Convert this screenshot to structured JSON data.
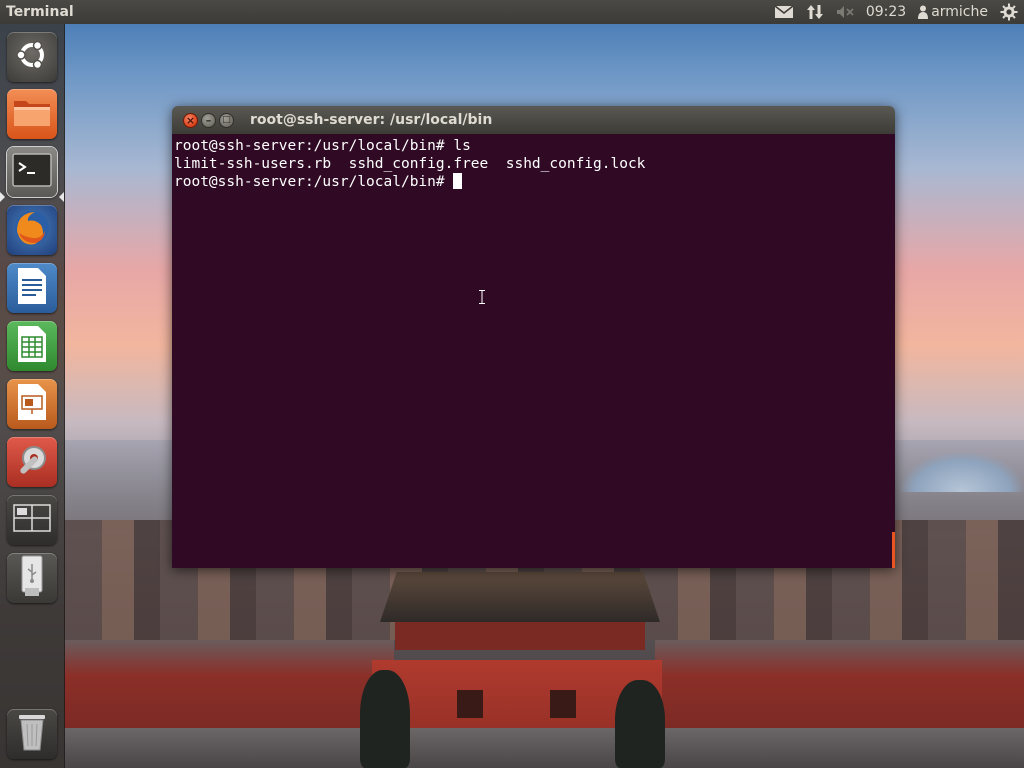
{
  "top_panel": {
    "app_title": "Terminal",
    "indicators": {
      "mail_icon": "mail-icon",
      "network_icon": "network-updown-icon",
      "volume_icon": "volume-muted-icon",
      "clock": "09:23",
      "user_name": "armiche",
      "session_icon": "gear-icon"
    }
  },
  "launcher": {
    "items": [
      {
        "name": "Dash Home",
        "icon": "ubuntu-logo-icon"
      },
      {
        "name": "Files",
        "icon": "folder-icon"
      },
      {
        "name": "Terminal",
        "icon": "terminal-icon",
        "active": true
      },
      {
        "name": "Firefox",
        "icon": "firefox-icon"
      },
      {
        "name": "LibreOffice Writer",
        "icon": "writer-icon"
      },
      {
        "name": "LibreOffice Calc",
        "icon": "calc-icon"
      },
      {
        "name": "LibreOffice Impress",
        "icon": "impress-icon"
      },
      {
        "name": "System Settings",
        "icon": "settings-icon"
      },
      {
        "name": "Workspace Switcher",
        "icon": "workspace-icon"
      },
      {
        "name": "USB Drive",
        "icon": "usb-icon"
      },
      {
        "name": "Trash",
        "icon": "trash-icon"
      }
    ]
  },
  "terminal": {
    "window_title": "root@ssh-server: /usr/local/bin",
    "buttons": {
      "close": "×",
      "minimize": "–",
      "maximize": "□"
    },
    "lines": [
      "root@ssh-server:/usr/local/bin# ls",
      "limit-ssh-users.rb  sshd_config.free  sshd_config.lock",
      "root@ssh-server:/usr/local/bin# "
    ]
  },
  "colors": {
    "terminal_bg": "#300a24",
    "panel_bg": "#3c3b37",
    "accent": "#e95420"
  }
}
